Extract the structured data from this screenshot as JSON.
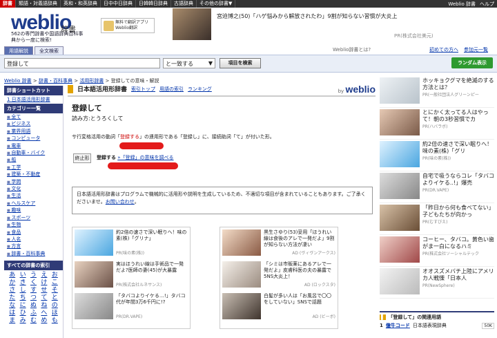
{
  "topnav": {
    "items": [
      "辞書",
      "類語・対義語辞典",
      "英和・和英辞典",
      "日中中日辞典",
      "日韓韓日辞典",
      "古語辞典",
      "その他の辞書▼"
    ],
    "right": [
      "Weblio 辞書",
      "ヘルプ"
    ]
  },
  "header": {
    "logo": "weblio",
    "logo_sub": "辞書",
    "tagline1": "562の専門辞書や国語辞典百科事",
    "tagline2": "典から一度に検索!",
    "promo": "無料で翻訳アプリ Weblio翻訳",
    "ad_text": "宮迫博之(50)「ハゲ悩みから解放されたわ」9割が知らない習慣が大炎上",
    "ad_pr": "PR(株式会社美元)"
  },
  "tabs": [
    "用語解説",
    "全文検索"
  ],
  "whatis": "Weblio辞書とは?",
  "links_right": [
    "初めての方へ",
    "参加元一覧"
  ],
  "search": {
    "value": "登録して",
    "mode": "と一致する",
    "button": "項目を検索",
    "random": "ランダム表示"
  },
  "breadcrumb": [
    "Weblio 辞書",
    "辞書・百科事典",
    "活用形辞書",
    "登録しての意味・解説"
  ],
  "sidebar": {
    "shortcut_header": "辞書ショートカット",
    "shortcut_item": "1 日本語活用形辞書",
    "category_header": "カテゴリー一覧",
    "categories": [
      "全て",
      "ビジネス",
      "業界用語",
      "コンピュータ",
      "電車",
      "自動車・バイク",
      "船",
      "工学",
      "建築・不動産",
      "学問",
      "文化",
      "生活",
      "ヘルスケア",
      "趣味",
      "スポーツ",
      "生物",
      "食品",
      "人名",
      "方言",
      "辞書・百科事典"
    ],
    "index_header": "すべての辞書の索引",
    "kana": [
      "あ",
      "い",
      "う",
      "え",
      "お",
      "か",
      "き",
      "く",
      "け",
      "こ",
      "さ",
      "し",
      "す",
      "せ",
      "そ",
      "た",
      "ち",
      "つ",
      "て",
      "と",
      "な",
      "に",
      "ぬ",
      "ね",
      "の",
      "は",
      "ひ",
      "ふ",
      "へ",
      "ほ",
      "ま",
      "み",
      "む",
      "め",
      "も"
    ]
  },
  "main": {
    "dict_title": "日本語活用形辞書",
    "links": [
      "索引トップ",
      "用語の索引",
      "ランキング"
    ],
    "by": "by",
    "by_logo": "weblio",
    "word": "登録して",
    "reading": "読み方:とうろくして",
    "def_pre": "サ行変格活用の動詞「",
    "def_link": "登録する",
    "def_post": "」の連用形である「登録し」に、接続助詞「て」が付いた形。",
    "conj_label": "終止形",
    "conj_word": "登録する",
    "conj_link": "»「登録」の意味を調べる",
    "note": "日本語活用形辞書はプログラムで機械的に活用形や説明を生成しているため、不適切な項目が含まれていることもあります。ご了承くださいませ。",
    "note_link": "お問い合わせ",
    "note_end": "。"
  },
  "ads": [
    {
      "text": "約2倍の速さで深い眠りへ！味の素(株)「グリナ」",
      "src": "PR(味の素(株))",
      "src2": ""
    },
    {
      "text": "黒生さゆり(53)妥用「ほうれい線は食後のアレで一発だよ」9割が知らない方法が凄い",
      "src": "",
      "src2": "AD (ヴィヴンアークス)"
    },
    {
      "text": "実はほうれい線は手術品で一発だよ?医師の妻(45)が大暴露",
      "src": "PR(株式会社ルネサンス)",
      "src2": ""
    },
    {
      "text": "「シミは市販薬にあるアレで一発だよ」皮膚科医の夫の暴露で5NS大炎上！",
      "src": "",
      "src2": "AD (ロックスタ)"
    },
    {
      "text": "「タバコよりイケる…!」タバコ代が年間3万6千円に!?",
      "src": "PR(DR.VAPE)",
      "src2": ""
    },
    {
      "text": "白髪が多い人は「お風呂で〇〇をしていない」SNSで話題",
      "src": "",
      "src2": "AD (ビーボ)"
    }
  ],
  "right_ads": [
    {
      "text": "ホッキョクグマを絶滅のする方法とは？",
      "src": "PR(一般社団法人グリーンピー"
    },
    {
      "text": "とにかく太ってる人はやって！朝の3秒習慣でカ",
      "src": "PR(ハバラボ)"
    },
    {
      "text": "約2倍の速さで深い眠りへ！味の素(株)「グリ",
      "src": "PR(味の素(株))"
    },
    {
      "text": "自宅で吸うならコレ「タバコよりイケる..!」爆売",
      "src": "PR(DR.VAPE)"
    },
    {
      "text": "「昨日から何も食べてない」子どもたちが向かっ",
      "src": "PR(むすびえ)"
    },
    {
      "text": "コーヒー、タバコ。黄色い歯がま一白になるハミ",
      "src": "PR(株式会社ソーシャルテック"
    },
    {
      "text": "オオスズメバチ上陸にアメリカ人戦慄「日本人",
      "src": "PR(NewSphere)"
    }
  ],
  "related": {
    "title": "「登録して」の関連用語",
    "num": "1",
    "word": "億牛コード",
    "dict": "日本語表現辞典",
    "badge": "50K"
  }
}
